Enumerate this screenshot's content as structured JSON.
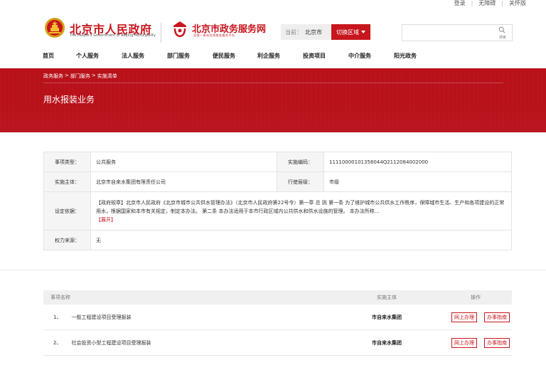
{
  "util_bar": [
    "登录",
    "无障碍",
    "关怀版"
  ],
  "header": {
    "gov_title": "北京市人民政府",
    "gov_subtitle": "The People's Government of Beijing Municipality",
    "svc_title": "北京市政务服务网",
    "svc_subtitle": "全国一体化在线政务服务平台",
    "location_label": "当前：",
    "location_city": "北京市",
    "switch_label": "切换区域",
    "search_label": "搜索",
    "search_value": ""
  },
  "nav": [
    "首页",
    "个人服务",
    "法人服务",
    "部门服务",
    "便民服务",
    "利企服务",
    "投资项目",
    "中介服务",
    "阳光政务"
  ],
  "banner": {
    "breadcrumb": [
      "政务服务",
      "部门服务",
      "实施清单"
    ],
    "title": "用水报装业务"
  },
  "info": {
    "type_label": "事项类型：",
    "type_value": "公共服务",
    "code_label": "实施编码：",
    "code_value": "11110000101358044Q2112084002000",
    "subject_label": "实施主体：",
    "subject_value": "北京市自来水集团有限责任公司",
    "level_label": "行使层级：",
    "level_value": "市级",
    "basis_label": "设定依据：",
    "basis_value": "【政府规章】北京市人民政府《北京市城市公共供水管理办法》（北京市人民政府第22号令）第一章 总 则 第一条 为了维护城市公共供水工作秩序，保障城市生活、生产和各项建设的正常用水，根据国家和本市有关规定，制定本办法。 第二条 本办法适用于本市行政区域内公共供水和供水设施的管理。 本办法所称…",
    "basis_expand": "【展开】",
    "power_label": "权力来源：",
    "power_value": "无"
  },
  "items": {
    "headers": [
      "事项名称",
      "实施主体",
      "操作"
    ],
    "rows": [
      {
        "num": "1、",
        "name": "一般工程建设项目受理报装",
        "subject": "市自来水集团",
        "btn1": "网上办理",
        "btn2": "办事指南"
      },
      {
        "num": "2、",
        "name": "社会投资小型工程建设项目受理报装",
        "subject": "市自来水集团",
        "btn1": "网上办理",
        "btn2": "办事指南"
      }
    ]
  },
  "colors": {
    "brand_red": "#c8161e",
    "banner_red": "#b8111a"
  }
}
